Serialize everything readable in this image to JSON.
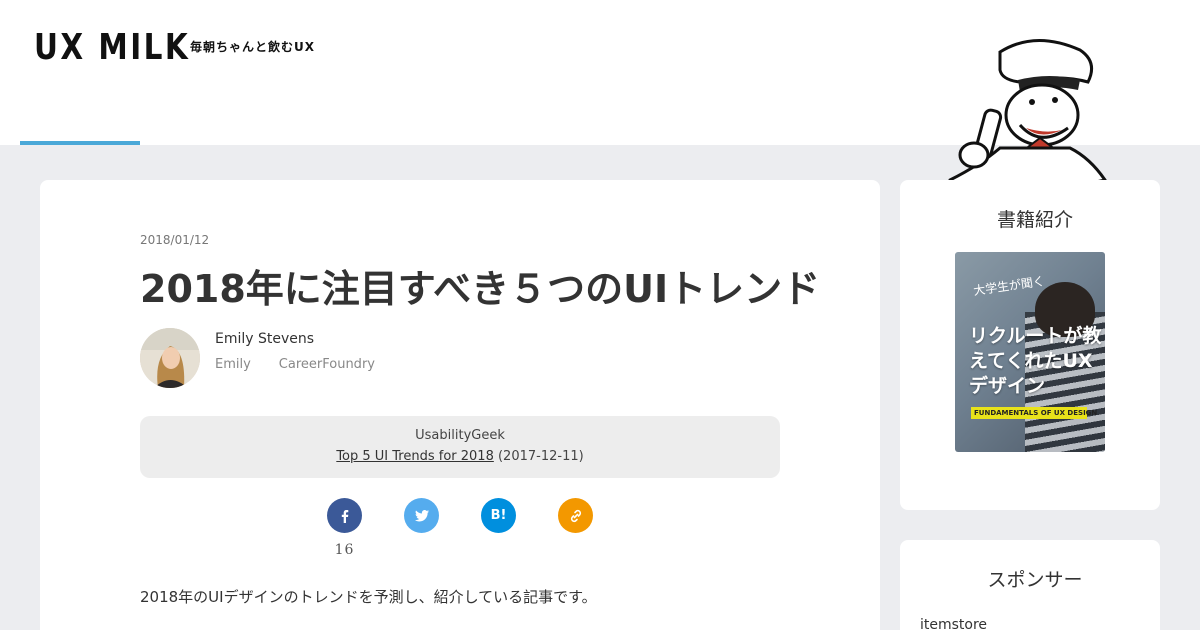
{
  "header": {
    "logo": "UX MILK",
    "tagline": "毎朝ちゃんと飲むUX"
  },
  "article": {
    "date": "2018/01/12",
    "title": "2018年に注目すべき５つのUIトレンド",
    "author": {
      "name": "Emily Stevens",
      "short_name": "Emily",
      "company": "CareerFoundry"
    },
    "source": {
      "site": "UsabilityGeek",
      "link_text": "Top 5 UI Trends for 2018",
      "date": "(2017-12-11)"
    },
    "share": {
      "facebook_count": "16",
      "hatena_label": "B!"
    },
    "lead": "2018年のUIデザインのトレンドを予測し、紹介している記事です。"
  },
  "sidebar": {
    "section1_title": "書籍紹介",
    "book": {
      "subtitle": "大学生が聞く",
      "title": "リクルートが教えてくれたUXデザイン",
      "band": "FUNDAMENTALS OF UX DESIGN"
    },
    "section2_title": "スポンサー",
    "section2_item": "itemstore"
  },
  "colors": {
    "accent": "#4aa8d8",
    "facebook": "#3b5998",
    "twitter": "#55acee",
    "hatena": "#008fde",
    "link": "#f39800"
  },
  "icons": [
    "facebook-icon",
    "twitter-icon",
    "hatena-icon",
    "link-icon"
  ]
}
